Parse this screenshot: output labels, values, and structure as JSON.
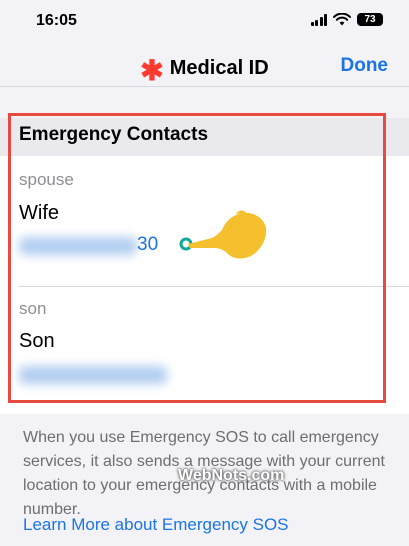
{
  "status": {
    "time": "16:05",
    "battery": "73"
  },
  "nav": {
    "title": "Medical ID",
    "done_label": "Done"
  },
  "section": {
    "title": "Emergency Contacts"
  },
  "contacts": [
    {
      "relation": "spouse",
      "name": "Wife",
      "phone_visible_suffix": "30"
    },
    {
      "relation": "son",
      "name": "Son"
    }
  ],
  "footer": {
    "text": "When you use Emergency SOS to call emergency services, it also sends a message with your current location to your emergency contacts with a mobile number.",
    "link": "Learn More about Emergency SOS"
  },
  "watermark": "WebNots.com",
  "colors": {
    "accent": "#1b74e4",
    "highlight": "#e84a3f",
    "asterisk": "#ff3b30",
    "pointer": "#f5c02e"
  }
}
